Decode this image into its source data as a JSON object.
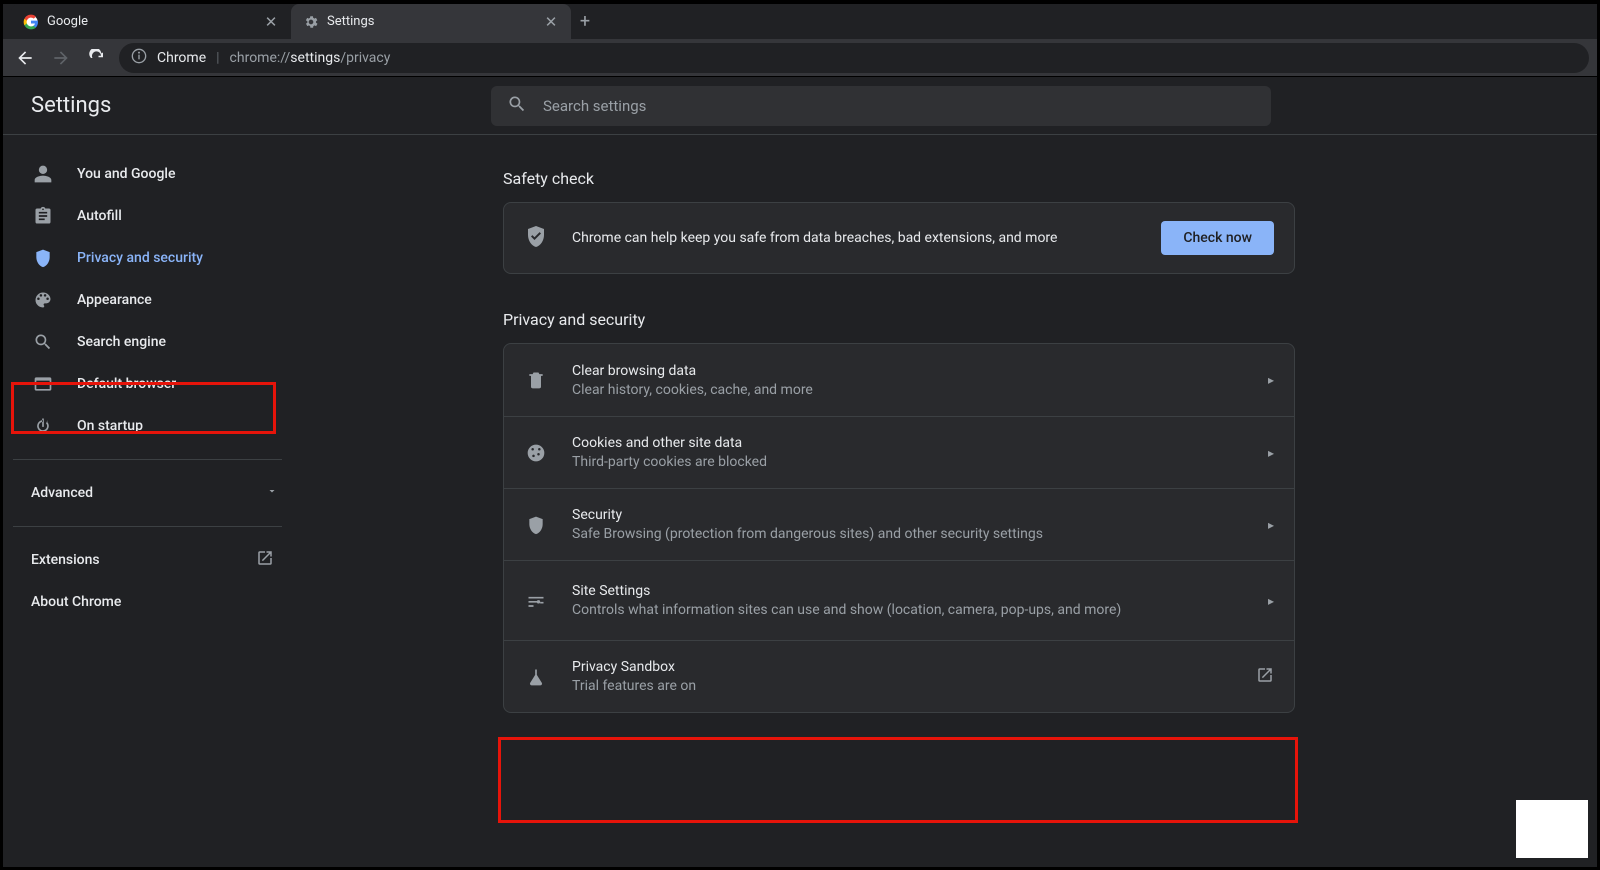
{
  "tabs": [
    {
      "title": "Google",
      "active": false
    },
    {
      "title": "Settings",
      "active": true
    }
  ],
  "omnibox": {
    "site_label": "Chrome",
    "url_prefix": "chrome://",
    "url_mid": "settings",
    "url_suffix": "/privacy"
  },
  "settings": {
    "title": "Settings",
    "search_placeholder": "Search settings"
  },
  "sidebar": {
    "items": [
      {
        "label": "You and Google"
      },
      {
        "label": "Autofill"
      },
      {
        "label": "Privacy and security"
      },
      {
        "label": "Appearance"
      },
      {
        "label": "Search engine"
      },
      {
        "label": "Default browser"
      },
      {
        "label": "On startup"
      }
    ],
    "advanced": "Advanced",
    "extensions": "Extensions",
    "about": "About Chrome"
  },
  "main": {
    "safety_heading": "Safety check",
    "safety_text": "Chrome can help keep you safe from data breaches, bad extensions, and more",
    "check_now": "Check now",
    "privacy_heading": "Privacy and security",
    "rows": [
      {
        "title": "Clear browsing data",
        "sub": "Clear history, cookies, cache, and more"
      },
      {
        "title": "Cookies and other site data",
        "sub": "Third-party cookies are blocked"
      },
      {
        "title": "Security",
        "sub": "Safe Browsing (protection from dangerous sites) and other security settings"
      },
      {
        "title": "Site Settings",
        "sub": "Controls what information sites can use and show (location, camera, pop-ups, and more)"
      },
      {
        "title": "Privacy Sandbox",
        "sub": "Trial features are on"
      }
    ]
  }
}
